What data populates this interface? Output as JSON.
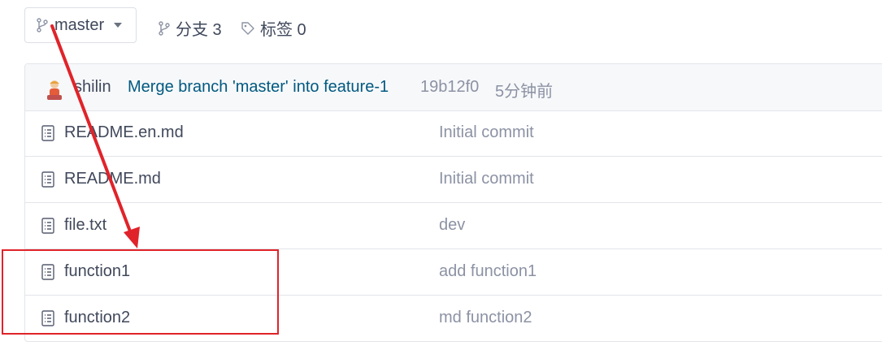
{
  "toolbar": {
    "branch_label": "master",
    "branches_label": "分支 3",
    "tags_label": "标签 0"
  },
  "last_commit": {
    "author": "shilin",
    "message": "Merge branch 'master' into feature-1",
    "hash": "19b12f0",
    "time": "5分钟前"
  },
  "files": [
    {
      "name": "README.en.md",
      "commit": "Initial commit"
    },
    {
      "name": "README.md",
      "commit": "Initial commit"
    },
    {
      "name": "file.txt",
      "commit": "dev"
    },
    {
      "name": "function1",
      "commit": "add function1"
    },
    {
      "name": "function2",
      "commit": "md function2"
    }
  ],
  "annotation_color": "#e0232a",
  "link_color": "#005980"
}
